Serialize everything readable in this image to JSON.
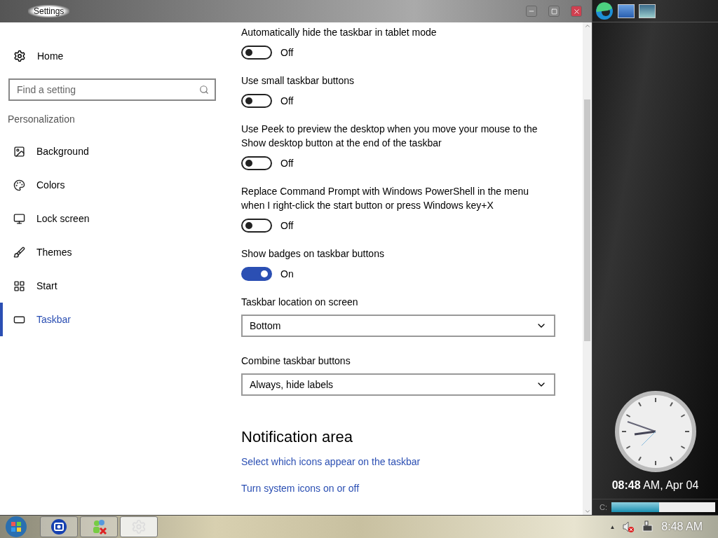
{
  "window": {
    "title": "Settings"
  },
  "sidebar": {
    "home": "Home",
    "search": {
      "placeholder": "Find a setting"
    },
    "section": "Personalization",
    "items": [
      {
        "label": "Background",
        "selected": false
      },
      {
        "label": "Colors",
        "selected": false
      },
      {
        "label": "Lock screen",
        "selected": false
      },
      {
        "label": "Themes",
        "selected": false
      },
      {
        "label": "Start",
        "selected": false
      },
      {
        "label": "Taskbar",
        "selected": true
      }
    ]
  },
  "settings": [
    {
      "kind": "toggle",
      "label": "Automatically hide the taskbar in tablet mode",
      "on": false,
      "state": "Off"
    },
    {
      "kind": "toggle",
      "label": "Use small taskbar buttons",
      "on": false,
      "state": "Off"
    },
    {
      "kind": "toggle",
      "label": "Use Peek to preview the desktop when you move your mouse to the Show desktop button at the end of the taskbar",
      "on": false,
      "state": "Off"
    },
    {
      "kind": "toggle",
      "label": "Replace Command Prompt with Windows PowerShell in the menu when I right-click the start button or press Windows key+X",
      "on": false,
      "state": "Off"
    },
    {
      "kind": "toggle",
      "label": "Show badges on taskbar buttons",
      "on": true,
      "state": "On"
    },
    {
      "kind": "dropdown",
      "label": "Taskbar location on screen",
      "value": "Bottom"
    },
    {
      "kind": "dropdown",
      "label": "Combine taskbar buttons",
      "value": "Always, hide labels"
    },
    {
      "kind": "heading",
      "label": "Notification area"
    },
    {
      "kind": "link",
      "label": "Select which icons appear on the taskbar"
    },
    {
      "kind": "link",
      "label": "Turn system icons on or off"
    }
  ],
  "gadgets": {
    "clock": "**08:48** AM, Apr 04",
    "drive": {
      "label": "C:",
      "level": 0.46
    }
  },
  "taskbar": {
    "time": "8:48 AM",
    "tray_expand": "▲"
  }
}
